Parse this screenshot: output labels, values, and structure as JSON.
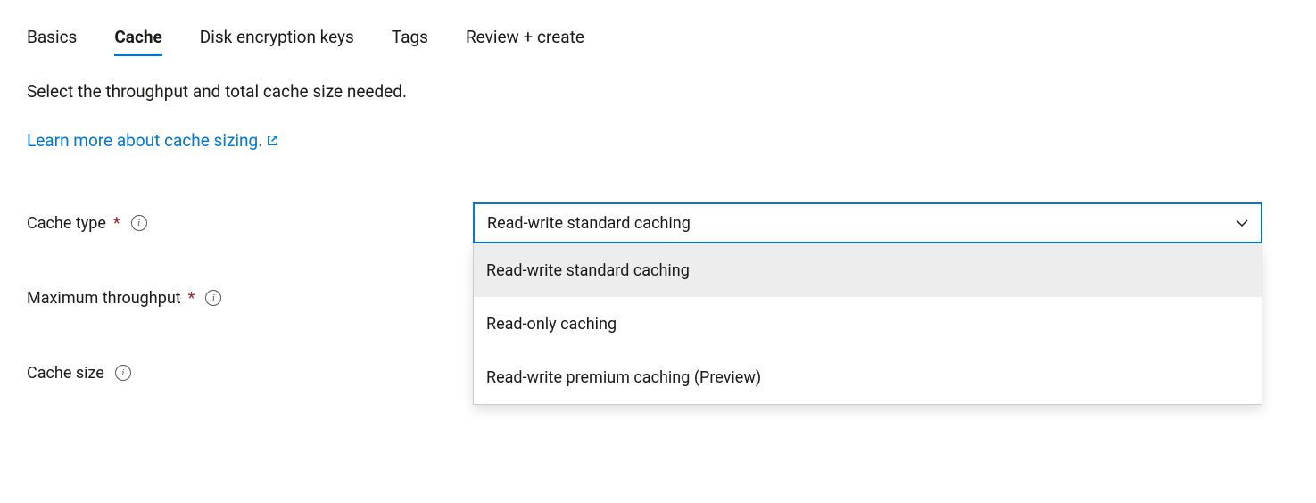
{
  "tabs": [
    {
      "label": "Basics",
      "active": false
    },
    {
      "label": "Cache",
      "active": true
    },
    {
      "label": "Disk encryption keys",
      "active": false
    },
    {
      "label": "Tags",
      "active": false
    },
    {
      "label": "Review + create",
      "active": false
    }
  ],
  "description": "Select the throughput and total cache size needed.",
  "learn_link": "Learn more about cache sizing.",
  "fields": {
    "cache_type": {
      "label": "Cache type",
      "required": true,
      "selected": "Read-write standard caching",
      "options": [
        {
          "label": "Read-write standard caching",
          "highlighted": true
        },
        {
          "label": "Read-only caching",
          "highlighted": false
        },
        {
          "label": "Read-write premium caching (Preview)",
          "highlighted": false
        }
      ]
    },
    "max_throughput": {
      "label": "Maximum throughput",
      "required": true
    },
    "cache_size": {
      "label": "Cache size",
      "required": false
    }
  }
}
